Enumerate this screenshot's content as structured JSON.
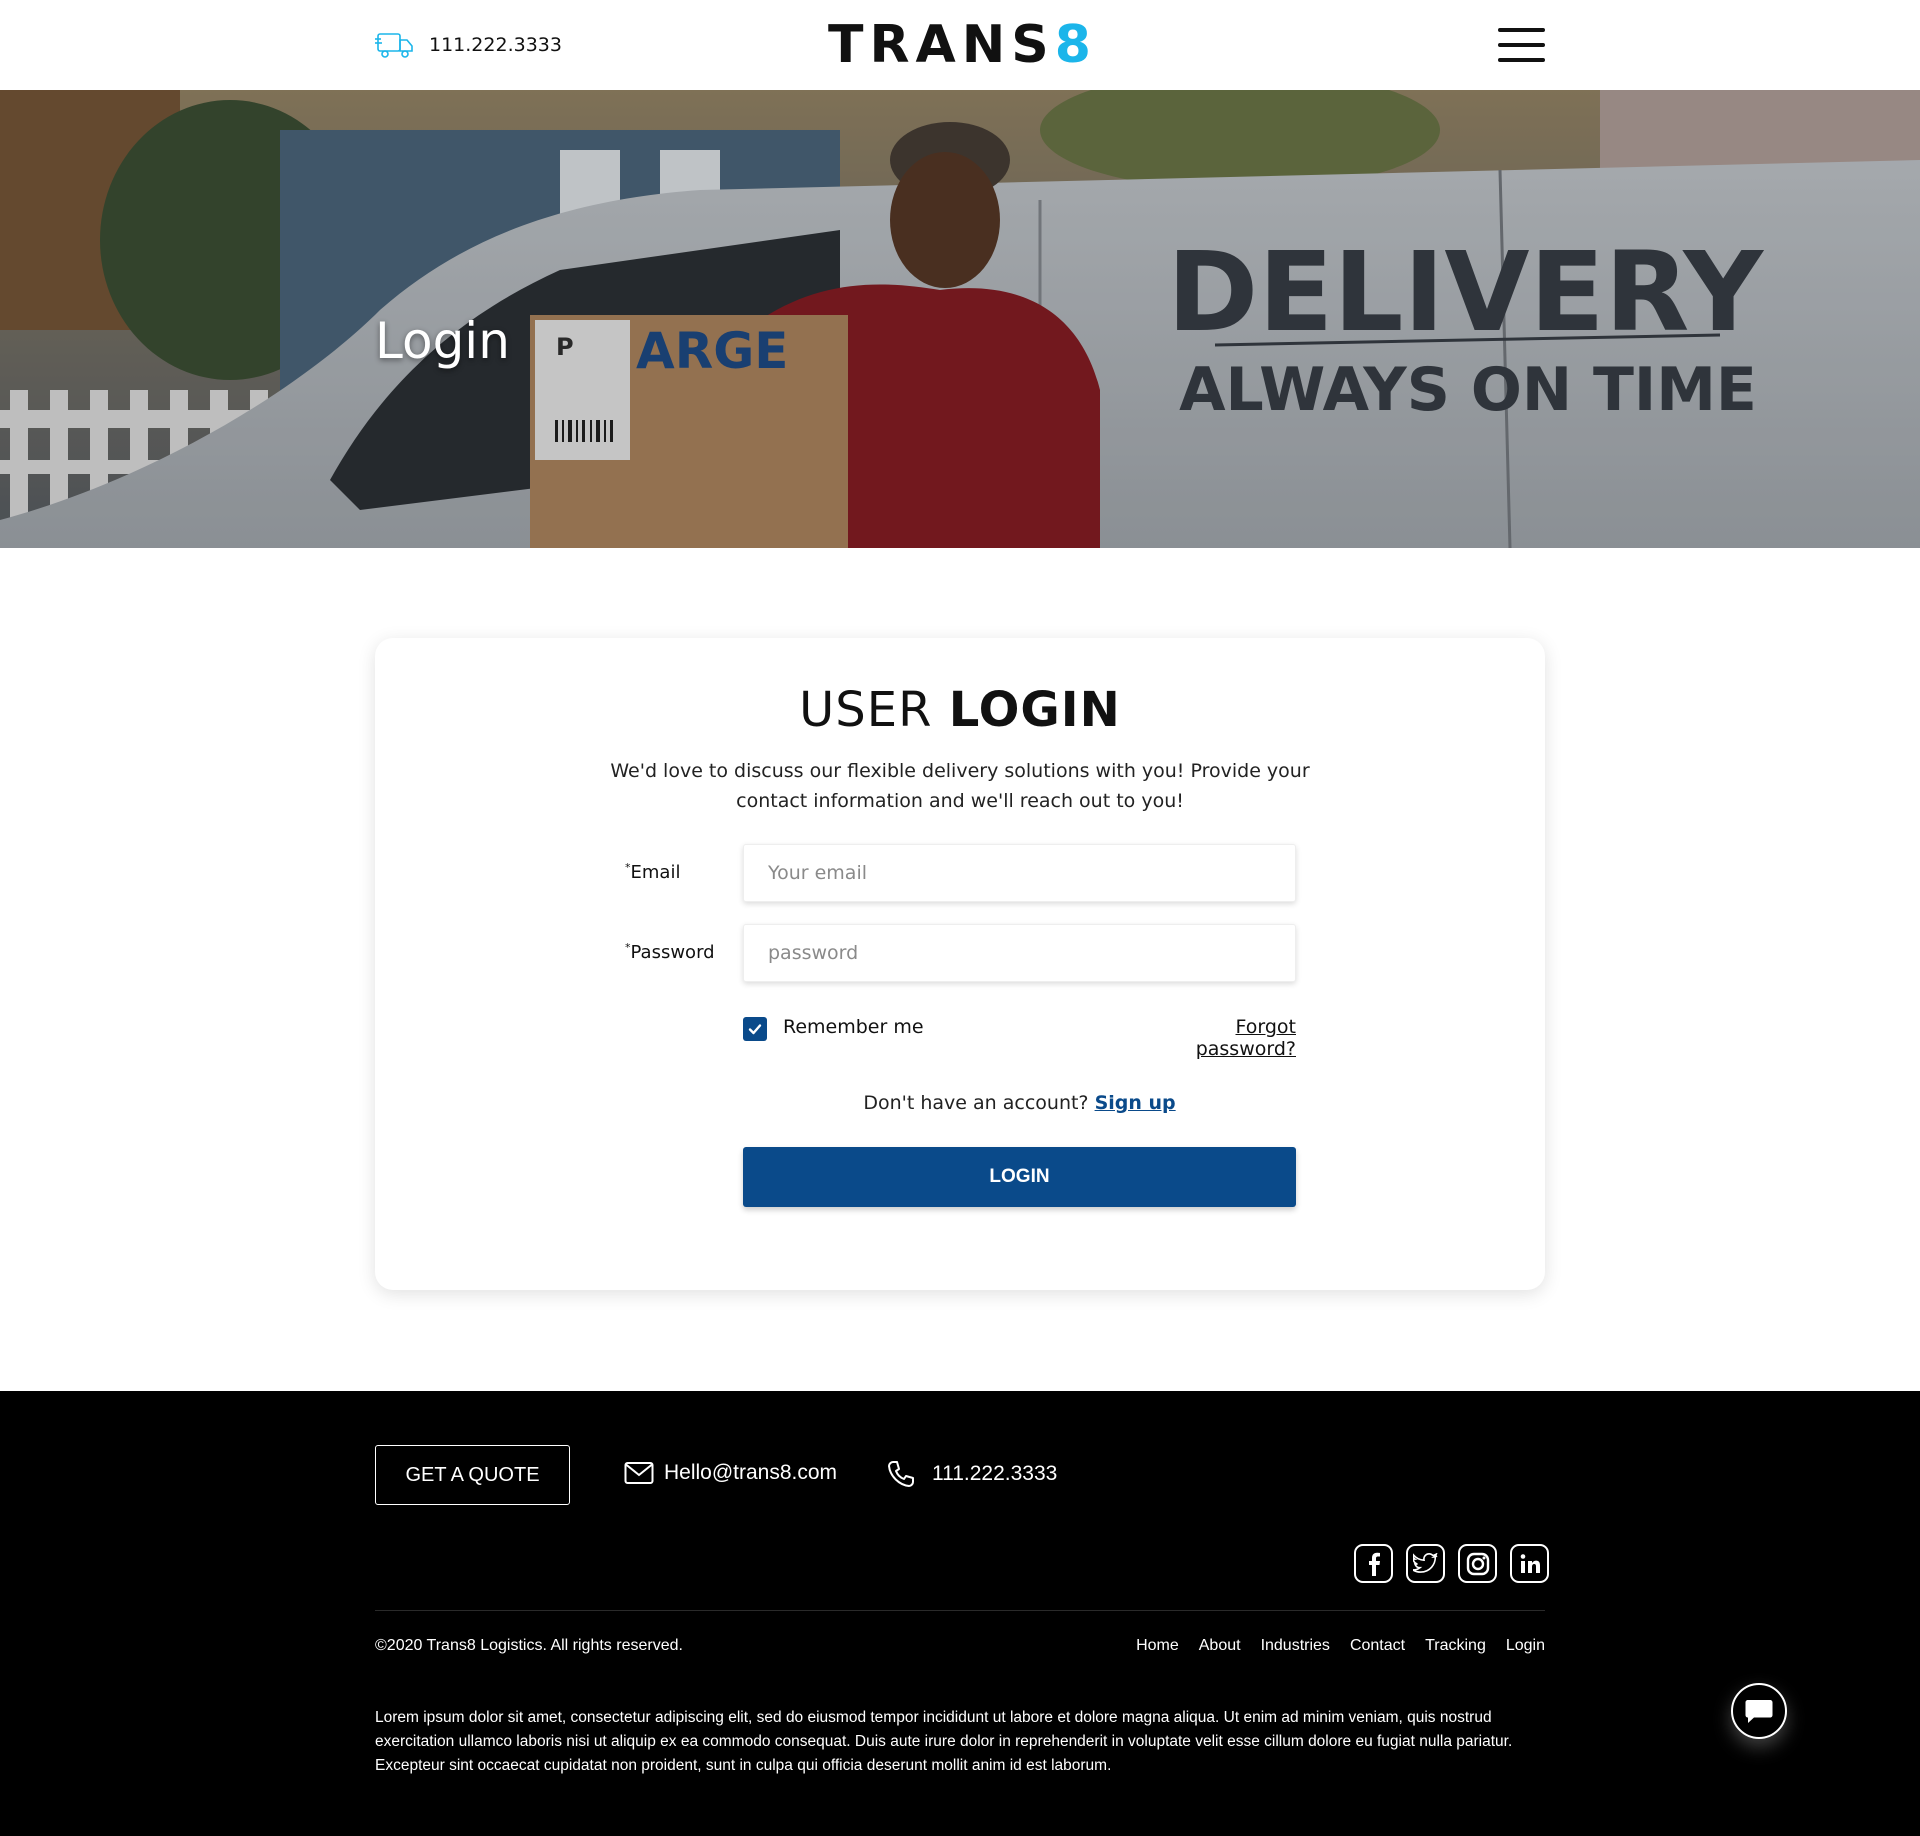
{
  "header": {
    "phone": "111.222.3333",
    "logo_main": "TRANS",
    "logo_accent": "8"
  },
  "hero": {
    "title": "Login",
    "van_text_line1": "DELIVERY",
    "van_text_line2": "ALWAYS ON TIME",
    "box_text": "ARGE",
    "label_letter": "P"
  },
  "login_card": {
    "title_light": "USER",
    "title_bold": "LOGIN",
    "description": "We'd love to discuss our flexible delivery solutions with you! Provide your contact information and we'll reach out to you!",
    "email_label": "Email",
    "email_placeholder": "Your email",
    "password_label": "Password",
    "password_placeholder": "password",
    "required_mark": "*",
    "remember_label": "Remember me",
    "remember_checked": true,
    "forgot_label": "Forgot password?",
    "no_account_text": "Don't have an account?",
    "signup_label": "Sign up",
    "login_button": "LOGIN"
  },
  "footer": {
    "quote_button": "GET A QUOTE",
    "email": "Hello@trans8.com",
    "phone": "111.222.3333",
    "socials": [
      "facebook-icon",
      "twitter-icon",
      "instagram-icon",
      "linkedin-icon"
    ],
    "copyright": "©2020 Trans8  Logistics. All rights reserved.",
    "nav": [
      "Home",
      "About",
      "Industries",
      "Contact",
      "Tracking",
      "Login"
    ],
    "lorem": "Lorem ipsum dolor sit amet, consectetur adipiscing elit, sed do eiusmod tempor incididunt ut labore et dolore magna aliqua. Ut enim ad minim veniam, quis nostrud exercitation ullamco laboris nisi ut aliquip ex ea commodo consequat. Duis aute irure dolor in reprehenderit in voluptate velit esse cillum dolore eu fugiat nulla pariatur. Excepteur sint occaecat cupidatat non proident, sunt in culpa qui officia deserunt mollit anim id est laborum."
  },
  "colors": {
    "accent": "#1bb5ea",
    "primary_button": "#0a4a8a",
    "footer_bg": "#000000"
  }
}
